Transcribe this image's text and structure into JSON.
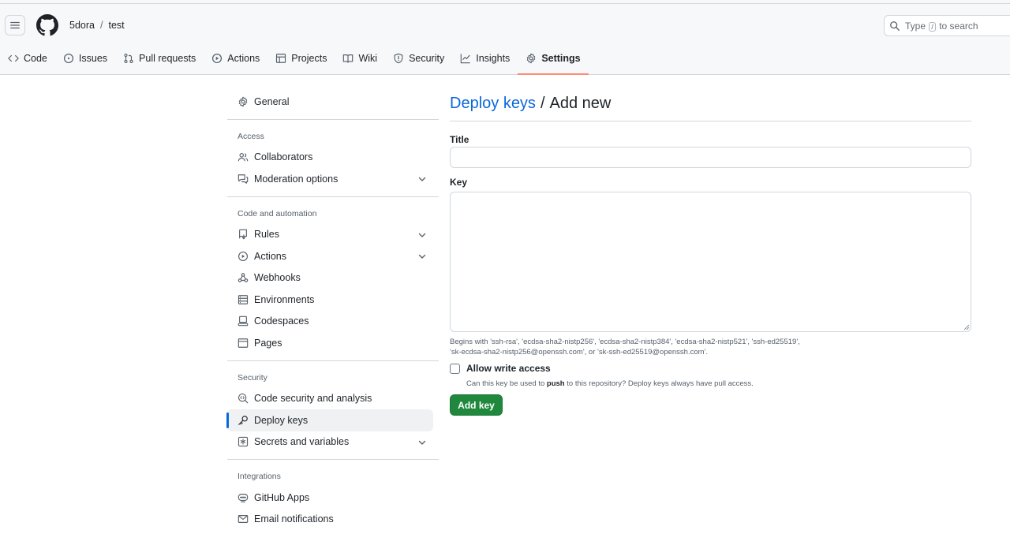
{
  "header": {
    "owner": "5dora",
    "separator": "/",
    "repo": "test",
    "search": {
      "prefix": "Type",
      "key": "/",
      "suffix": "to search"
    }
  },
  "tabs": [
    {
      "label": "Code",
      "icon": "code-icon"
    },
    {
      "label": "Issues",
      "icon": "issue-icon"
    },
    {
      "label": "Pull requests",
      "icon": "pull-request-icon"
    },
    {
      "label": "Actions",
      "icon": "play-icon"
    },
    {
      "label": "Projects",
      "icon": "table-icon"
    },
    {
      "label": "Wiki",
      "icon": "book-icon"
    },
    {
      "label": "Security",
      "icon": "shield-icon"
    },
    {
      "label": "Insights",
      "icon": "graph-icon"
    },
    {
      "label": "Settings",
      "icon": "gear-icon",
      "selected": true
    }
  ],
  "sidebar": {
    "general": "General",
    "sections": [
      {
        "heading": "Access",
        "items": [
          "Collaborators",
          "Moderation options"
        ]
      },
      {
        "heading": "Code and automation",
        "items": [
          "Rules",
          "Actions",
          "Webhooks",
          "Environments",
          "Codespaces",
          "Pages"
        ]
      },
      {
        "heading": "Security",
        "items": [
          "Code security and analysis",
          "Deploy keys",
          "Secrets and variables"
        ]
      },
      {
        "heading": "Integrations",
        "items": [
          "GitHub Apps",
          "Email notifications"
        ]
      }
    ],
    "active": "Deploy keys"
  },
  "main": {
    "title_link": "Deploy keys",
    "title_sep": "/",
    "title_rest": "Add new",
    "title_label": "Title",
    "title_value": "",
    "key_label": "Key",
    "key_value": "",
    "key_note_1": "Begins with 'ssh-rsa', 'ecdsa-sha2-nistp256', 'ecdsa-sha2-nistp384', 'ecdsa-sha2-nistp521', 'ssh-ed25519',",
    "key_note_2": "'sk-ecdsa-sha2-nistp256@openssh.com', or 'sk-ssh-ed25519@openssh.com'.",
    "write_label": "Allow write access",
    "write_help_pre": "Can this key be used to ",
    "write_help_bold": "push",
    "write_help_post": " to this repository? Deploy keys always have pull access.",
    "submit_label": "Add key"
  },
  "colors": {
    "accent": "#0969da",
    "primary_button": "#1f883d",
    "tab_underline": "#fd8c73"
  }
}
